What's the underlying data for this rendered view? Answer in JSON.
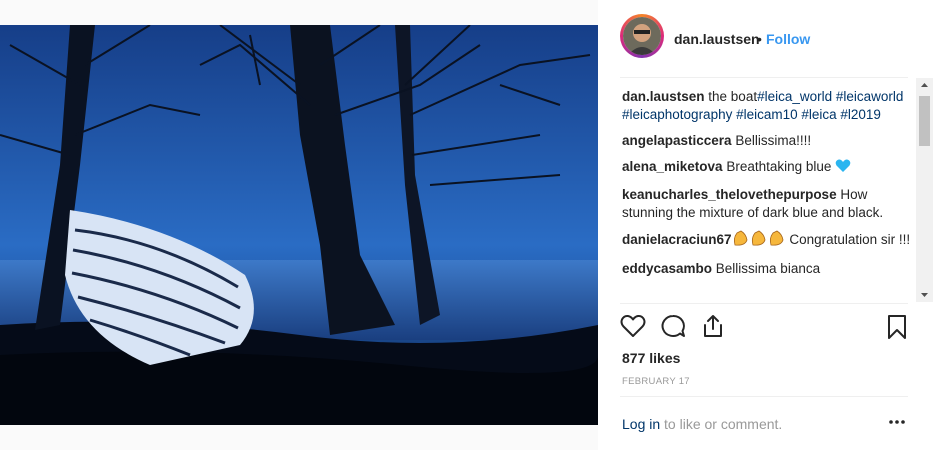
{
  "post": {
    "username": "dan.laustsen",
    "separator": "•",
    "follow_label": "Follow",
    "likes": "877 likes",
    "date": "FEBRUARY 17",
    "login_link": "Log in",
    "login_rest": " to like or comment."
  },
  "caption": {
    "user": "dan.laustsen",
    "text": " the boat",
    "tags": "#leica_world #leicaworld #leicaphotography #leicam10 #leica #l2019"
  },
  "comments": [
    {
      "user": "angelapasticcera",
      "text": " Bellissima!!!!"
    },
    {
      "user": "alena_miketova",
      "text": " Breathtaking blue "
    },
    {
      "user": "keanucharles_thelovethepurpose",
      "text": " How stunning the mixture of dark blue and black."
    },
    {
      "user": "danielacraciun67",
      "text": " Congratulation sir !!!"
    },
    {
      "user": "eddycasambo",
      "text": " Bellissima bianca"
    }
  ],
  "icons": [
    "heart-icon",
    "comment-icon",
    "share-icon",
    "bookmark-icon",
    "more-options-icon",
    "blue-heart-emoji",
    "clapping-hands-emoji"
  ],
  "colors": {
    "follow": "#3897f0",
    "tag": "#003569",
    "photo_sky": "#1f57a8"
  }
}
